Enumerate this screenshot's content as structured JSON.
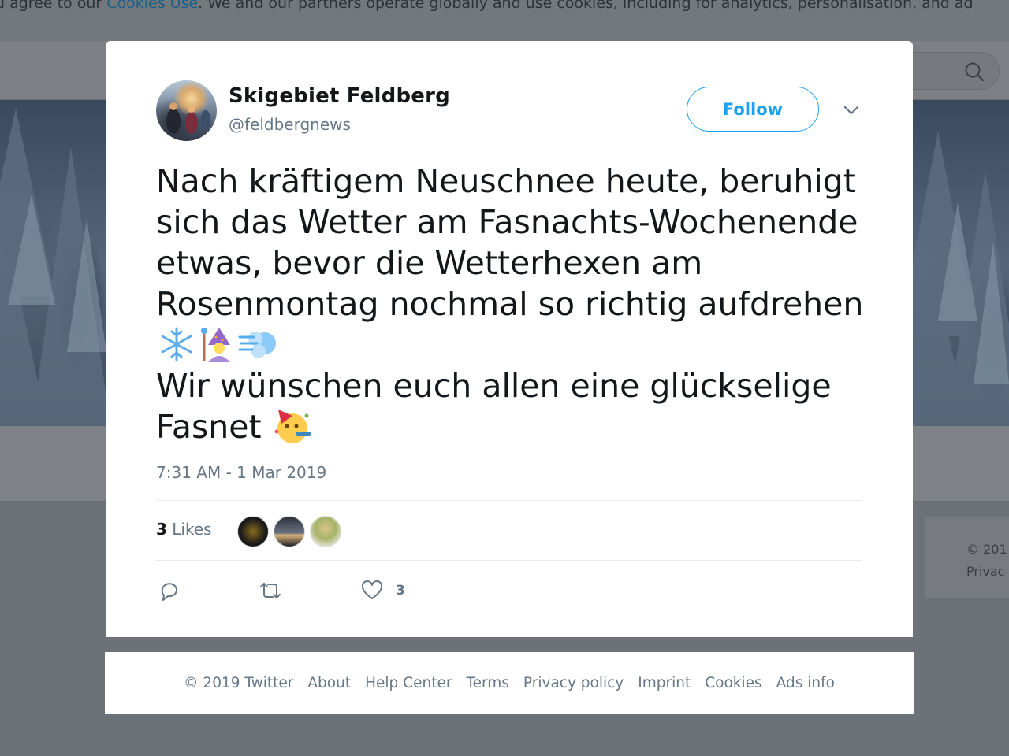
{
  "cookie_bar": {
    "text_before": "u agree to our ",
    "link": "Cookies Use",
    "text_after": ". We and our partners operate globally and use cookies, including for analytics, personalisation, and ad"
  },
  "side_card": {
    "line1": "© 201",
    "line2": "Privac"
  },
  "tweet": {
    "user_name": "Skigebiet Feldberg",
    "handle": "@feldbergnews",
    "follow_label": "Follow",
    "text_part1": "Nach kräftigem Neuschnee heute, beruhigt sich das Wetter am Fasnachts-Wochenende etwas, bevor die Wetterhexen am Rosenmontag nochmal so richtig aufdrehen",
    "text_part2": "Wir wünschen euch allen eine glückselige Fasnet",
    "emojis": [
      "snowflake-icon",
      "mage-icon",
      "wind-icon",
      "party-face-icon"
    ],
    "timestamp": "7:31 AM - 1 Mar 2019",
    "likes_count": "3",
    "likes_label": "Likes",
    "like_action_count": "3"
  },
  "footer": {
    "copyright": "© 2019 Twitter",
    "links": [
      "About",
      "Help Center",
      "Terms",
      "Privacy policy",
      "Imprint",
      "Cookies",
      "Ads info"
    ]
  },
  "colors": {
    "accent": "#1da1f2",
    "text": "#14171a",
    "secondary": "#657786",
    "overlay": "#6c7278"
  }
}
